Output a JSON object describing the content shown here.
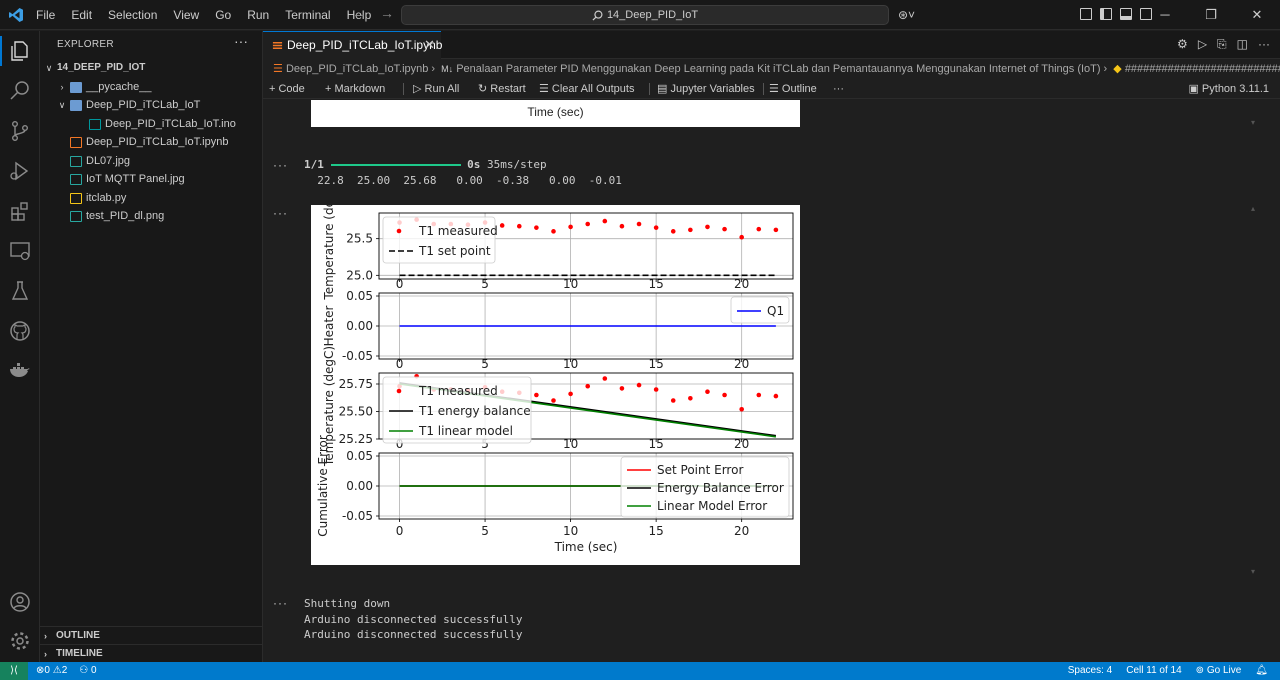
{
  "menu": [
    "File",
    "Edit",
    "Selection",
    "View",
    "Go",
    "Run",
    "Terminal",
    "Help"
  ],
  "search": {
    "text": "14_Deep_PID_IoT"
  },
  "explorer": {
    "title": "EXPLORER",
    "workspace": "14_DEEP_PID_IOT",
    "items": [
      {
        "label": "__pycache__",
        "type": "folder",
        "depth": 1,
        "expanded": false
      },
      {
        "label": "Deep_PID_iTCLab_IoT",
        "type": "folder",
        "depth": 1,
        "expanded": true
      },
      {
        "label": "Deep_PID_iTCLab_IoT.ino",
        "type": "ino",
        "depth": 2
      },
      {
        "label": "Deep_PID_iTCLab_IoT.ipynb",
        "type": "ipynb",
        "depth": 1
      },
      {
        "label": "DL07.jpg",
        "type": "img",
        "depth": 1
      },
      {
        "label": "IoT MQTT Panel.jpg",
        "type": "img",
        "depth": 1
      },
      {
        "label": "itclab.py",
        "type": "py",
        "depth": 1
      },
      {
        "label": "test_PID_dl.png",
        "type": "img",
        "depth": 1
      }
    ],
    "outline": "OUTLINE",
    "timeline": "TIMELINE"
  },
  "tab": {
    "label": "Deep_PID_iTCLab_IoT.ipynb"
  },
  "breadcrumb": {
    "file": "Deep_PID_iTCLab_IoT.ipynb",
    "md": "M↓",
    "heading": "Penalaan Parameter PID Menggunakan Deep Learning pada Kit iTCLab dan Pemantauannya Menggunakan Internet of Things (IoT)",
    "code": "################################"
  },
  "toolbar": {
    "code": "Code",
    "markdown": "Markdown",
    "run_all": "Run All",
    "restart": "Restart",
    "clear": "Clear All Outputs",
    "variables": "Jupyter Variables",
    "outline": "Outline",
    "more": "···",
    "kernel": "Python 3.11.1"
  },
  "output1": {
    "progress_label": "1/1",
    "progress_time": "0s",
    "progress_rate": "35ms/step",
    "progress_fraction": 1.0,
    "values_line": "  22.8  25.00  25.68   0.00  -0.38   0.00  -0.01"
  },
  "top_figure_xlabel": "Time (sec)",
  "chart_data": [
    {
      "type": "scatter",
      "id": "p1",
      "ylabel": "Temperature (deg",
      "yticks": [
        "25.5",
        "25.0"
      ],
      "ylim": [
        24.95,
        25.85
      ],
      "xticks": [
        "0",
        "5",
        "10",
        "15",
        "20"
      ],
      "xlim": [
        -1.2,
        23
      ],
      "grid": true,
      "legend_placement": "upper-left",
      "series": [
        {
          "name": "T1 measured",
          "kind": "points",
          "color": "#ff0000",
          "x": [
            0,
            1,
            2,
            3,
            4,
            5,
            6,
            7,
            8,
            9,
            10,
            11,
            12,
            13,
            14,
            15,
            16,
            17,
            18,
            19,
            20,
            21,
            22
          ],
          "y": [
            25.72,
            25.76,
            25.7,
            25.7,
            25.69,
            25.72,
            25.68,
            25.67,
            25.65,
            25.6,
            25.66,
            25.7,
            25.74,
            25.67,
            25.7,
            25.65,
            25.6,
            25.62,
            25.66,
            25.63,
            25.52,
            25.63,
            25.62
          ]
        },
        {
          "name": "T1 set point",
          "kind": "dashed",
          "color": "#000000",
          "x": [
            0,
            22
          ],
          "y": [
            25.0,
            25.0
          ]
        }
      ]
    },
    {
      "type": "line",
      "id": "p2",
      "ylabel": "Heater",
      "yticks": [
        "0.05",
        "0.00",
        "-0.05"
      ],
      "ylim": [
        -0.055,
        0.055
      ],
      "xticks": [
        "0",
        "5",
        "10",
        "15",
        "20"
      ],
      "xlim": [
        -1.2,
        23
      ],
      "grid": true,
      "legend_placement": "upper-right",
      "series": [
        {
          "name": "Q1",
          "kind": "line",
          "color": "#0000ff",
          "x": [
            0,
            22
          ],
          "y": [
            0,
            0
          ]
        }
      ]
    },
    {
      "type": "line",
      "id": "p3",
      "ylabel": "Temperature (degC)",
      "yticks": [
        "25.75",
        "25.50",
        "25.25"
      ],
      "ylim": [
        25.25,
        25.85
      ],
      "xticks": [
        "0",
        "5",
        "10",
        "15",
        "20"
      ],
      "xlim": [
        -1.2,
        23
      ],
      "grid": true,
      "legend_placement": "upper-left",
      "series": [
        {
          "name": "T1 measured",
          "kind": "points",
          "color": "#ff0000",
          "x": [
            0,
            1,
            2,
            3,
            4,
            5,
            6,
            7,
            8,
            9,
            10,
            11,
            12,
            13,
            14,
            15,
            16,
            17,
            18,
            19,
            20,
            21,
            22
          ],
          "y": [
            25.73,
            25.82,
            25.7,
            25.7,
            25.69,
            25.72,
            25.68,
            25.67,
            25.65,
            25.6,
            25.66,
            25.73,
            25.8,
            25.71,
            25.74,
            25.7,
            25.6,
            25.62,
            25.68,
            25.65,
            25.52,
            25.65,
            25.64
          ]
        },
        {
          "name": "T1 energy balance",
          "kind": "line",
          "color": "#000000",
          "x": [
            0,
            22
          ],
          "y": [
            25.76,
            25.28
          ]
        },
        {
          "name": "T1 linear model",
          "kind": "line",
          "color": "#008000",
          "x": [
            0,
            22
          ],
          "y": [
            25.75,
            25.27
          ]
        }
      ]
    },
    {
      "type": "line",
      "id": "p4",
      "ylabel": "Cumulative Error",
      "yticks": [
        "0.05",
        "0.00",
        "-0.05"
      ],
      "ylim": [
        -0.055,
        0.055
      ],
      "xticks": [
        "0",
        "5",
        "10",
        "15",
        "20"
      ],
      "xlim": [
        -1.2,
        23
      ],
      "xlabel": "Time (sec)",
      "grid": true,
      "legend_placement": "lower-right",
      "series": [
        {
          "name": "Set Point Error",
          "kind": "line",
          "color": "#ff0000",
          "x": [
            0,
            22
          ],
          "y": [
            0,
            0
          ]
        },
        {
          "name": "Energy Balance Error",
          "kind": "line",
          "color": "#000000",
          "x": [
            0,
            22
          ],
          "y": [
            0,
            0
          ]
        },
        {
          "name": "Linear Model Error",
          "kind": "line",
          "color": "#008000",
          "x": [
            0,
            22
          ],
          "y": [
            0,
            0
          ]
        }
      ]
    }
  ],
  "output3": {
    "lines": [
      "Shutting down",
      "Arduino disconnected successfully",
      "Arduino disconnected successfully"
    ]
  },
  "status": {
    "errors": "0",
    "warnings": "2",
    "ports": "0",
    "spaces": "Spaces: 4",
    "cell": "Cell 11 of 14",
    "golive": "Go Live"
  },
  "colors": {
    "accent": "#0078d4",
    "status_bar": "#007acc",
    "progress": "#1ec98a"
  }
}
